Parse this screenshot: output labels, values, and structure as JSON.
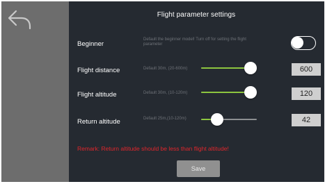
{
  "header": {
    "title": "Flight parameter settings",
    "back_icon": "back-arrow-icon"
  },
  "beginner": {
    "label": "Beginner",
    "hint": "Default the beginner model! Turn off for setting the flight parameter",
    "enabled": false
  },
  "flight_distance": {
    "label": "Flight distance",
    "hint": "Default 30m, (20-600m)",
    "value": "600",
    "min": 20,
    "max": 600,
    "current": 600
  },
  "flight_altitude": {
    "label": "Flight altitude",
    "hint": "Default 30m, (10-120m)",
    "value": "120",
    "min": 10,
    "max": 120,
    "current": 120
  },
  "return_altitude": {
    "label": "Return altitude",
    "hint": "Default 25m,(10-120m)",
    "value": "42",
    "min": 10,
    "max": 120,
    "current": 42
  },
  "remark": "Remark: Return altitude should be less than flight altitude!",
  "save_label": "Save",
  "colors": {
    "background": "#252a31",
    "sidebar": "#6d6d6d",
    "slider_fill": "#8dc63f",
    "remark": "#e0262c"
  }
}
